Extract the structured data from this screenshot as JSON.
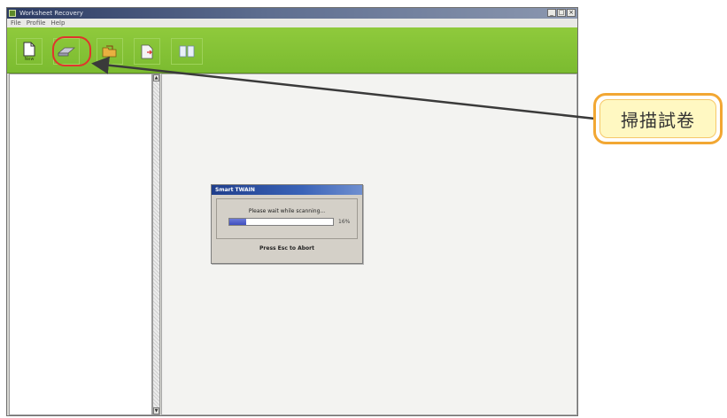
{
  "window": {
    "title": "Worksheet Recovery",
    "controls": [
      "_",
      "□",
      "×"
    ]
  },
  "menu": [
    "File",
    "Profile",
    "Help"
  ],
  "toolbar": {
    "buttons": [
      {
        "icon": "new-document-icon",
        "label": "New"
      },
      {
        "icon": "scanner-icon",
        "label": ""
      },
      {
        "icon": "open-folder-icon",
        "label": ""
      },
      {
        "icon": "export-icon",
        "label": ""
      },
      {
        "icon": "book-icon",
        "label": ""
      }
    ]
  },
  "scrollbar": {
    "up": "▲",
    "down": "▼"
  },
  "dialog": {
    "title": "Smart TWAIN",
    "message": "Please wait while scanning...",
    "progress_percent": 16,
    "progress_text": "16%",
    "abort_text": "Press Esc to Abort"
  },
  "callout": {
    "text": "掃描試卷"
  },
  "colors": {
    "toolbar_green": "#8fca3c",
    "highlight_red": "#e0352c",
    "callout_border": "#f2a733",
    "callout_fill": "#fff8c2",
    "progress_fill": "#3f4fbf"
  }
}
